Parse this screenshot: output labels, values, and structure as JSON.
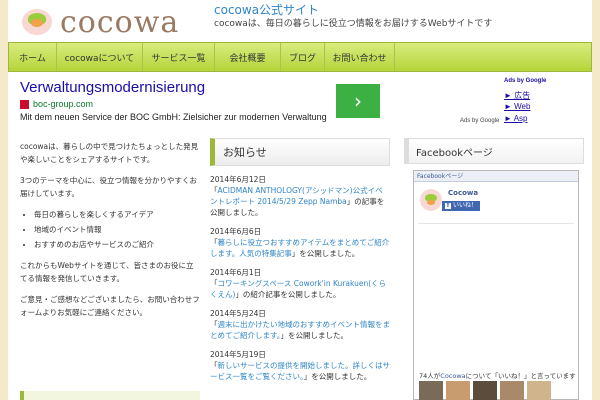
{
  "header": {
    "logo_text": "cocowa",
    "site_title": "cocowa公式サイト",
    "site_description": "cocowaは、毎日の暮らしに役立つ情報をお届けするWebサイトです"
  },
  "nav": {
    "items": [
      {
        "label": "ホーム"
      },
      {
        "label": "cocowaについて"
      },
      {
        "label": "サービス一覧"
      },
      {
        "label": "会社概要"
      },
      {
        "label": "ブログ"
      },
      {
        "label": "お問い合わせ"
      }
    ]
  },
  "ad": {
    "headline": "Verwaltungsmodernisierung",
    "url": "boc-group.com",
    "description": "Mit dem neuen Service der BOC GmbH: Zielsicher zur modernen Verwaltung",
    "arrow": "›",
    "ads_by_google_title": "Ads by Google",
    "side_links": [
      "► 広告",
      "► Web",
      "► Asp"
    ],
    "ads_by_google_footer": "Ads by Google"
  },
  "intro": {
    "paragraph1": "cocowaは、暮らしの中で見つけたちょっとした発見や楽しいことをシェアするサイトです。",
    "paragraph2": "3つのテーマを中心に、役立つ情報を分かりやすくお届けしています。",
    "bullets": [
      "毎日の暮らしを楽しくするアイデア",
      "地域のイベント情報",
      "おすすめのお店やサービスのご紹介"
    ],
    "paragraph3": "これからもWebサイトを通じて、皆さまのお役に立てる情報を発信していきます。",
    "paragraph4": "ご意見・ご感想などございましたら、お問い合わせフォームよりお気軽にご連絡ください。"
  },
  "news": {
    "title": "お知らせ",
    "items": [
      {
        "date": "2014年6月12日",
        "prefix": "「",
        "link": "ACIDMAN ANTHOLOGY(アシッドマン)公式イベントレポート 2014/5/29 Zepp Namba",
        "suffix": "」の記事を公開しました。"
      },
      {
        "date": "2014年6月6日",
        "prefix": "「",
        "link": "暮らしに役立つおすすめアイテムをまとめてご紹介します。人気の特集記事",
        "suffix": "」を公開しました。"
      },
      {
        "date": "2014年6月1日",
        "prefix": "「",
        "link": "コワーキングスペース Cowork'in Kurakuen(くらくえん)",
        "suffix": "」の紹介記事を公開しました。"
      },
      {
        "date": "2014年5月24日",
        "prefix": "「",
        "link": "週末に出かけたい地域のおすすめイベント情報をまとめてご紹介します。",
        "suffix": "」を公開しました。"
      },
      {
        "date": "2014年5月19日",
        "prefix": "「",
        "link": "新しいサービスの提供を開始しました。詳しくはサービス一覧をご覧ください。",
        "suffix": "」を公開しました。"
      }
    ]
  },
  "sidebar": {
    "facebook_title": "Facebookページ",
    "fb_box_title": "Facebookページ",
    "fb_page_name": "Cocowa",
    "fb_like_label": "いいね！",
    "fb_count_prefix": "74人が",
    "fb_count_link": "Cocowa",
    "fb_count_suffix": "について「いいね！」と言っています",
    "fb_face_colors": [
      "#7a6a58",
      "#c89c6e",
      "#5c4c3c",
      "#a88a6a",
      "#d0b48c"
    ]
  },
  "colors": {
    "nav_gradient_top": "#d8ec7e",
    "nav_gradient_bottom": "#b6d43a",
    "accent_green": "#9cb83a",
    "link_blue": "#2f86c8",
    "page_background": "#f4e9c8"
  }
}
